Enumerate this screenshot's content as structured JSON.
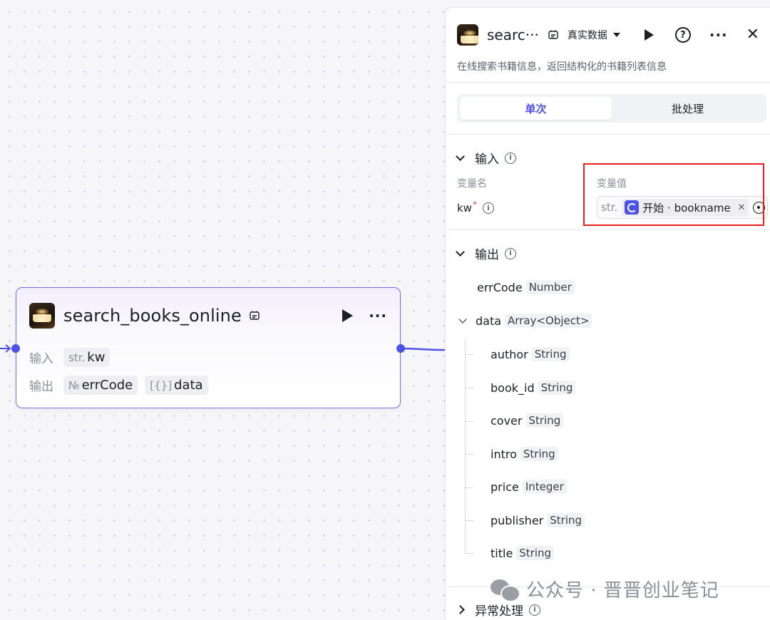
{
  "node": {
    "title": "search_books_online",
    "input_label": "输入",
    "output_label": "输出",
    "inputs": [
      {
        "type": "str.",
        "name": "kw"
      }
    ],
    "outputs": [
      {
        "type": "№",
        "name": "errCode"
      },
      {
        "type": "[{}]",
        "name": "data"
      }
    ]
  },
  "panel": {
    "title": "searc···",
    "env_label": "真实数据",
    "description": "在线搜索书籍信息，返回结构化的书籍列表信息",
    "tabs": [
      {
        "label": "单次"
      },
      {
        "label": "批处理"
      }
    ],
    "input_section": {
      "title": "输入",
      "col_name": "变量名",
      "col_value": "变量值",
      "param_name": "kw",
      "param_required": "*",
      "value_type": "str.",
      "value_ref": "开始 · bookname"
    },
    "output_section": {
      "title": "输出",
      "items": [
        {
          "name": "errCode",
          "type": "Number"
        },
        {
          "name": "data",
          "type": "Array<Object>"
        }
      ],
      "children": [
        {
          "name": "author",
          "type": "String"
        },
        {
          "name": "book_id",
          "type": "String"
        },
        {
          "name": "cover",
          "type": "String"
        },
        {
          "name": "intro",
          "type": "String"
        },
        {
          "name": "price",
          "type": "Integer"
        },
        {
          "name": "publisher",
          "type": "String"
        },
        {
          "name": "title",
          "type": "String"
        }
      ]
    },
    "exception_section": {
      "title": "异常处理"
    }
  },
  "watermark": {
    "text": "公众号 · 晋晋创业笔记"
  },
  "colors": {
    "accent": "#4d53e8",
    "highlight": "#e8201a"
  }
}
